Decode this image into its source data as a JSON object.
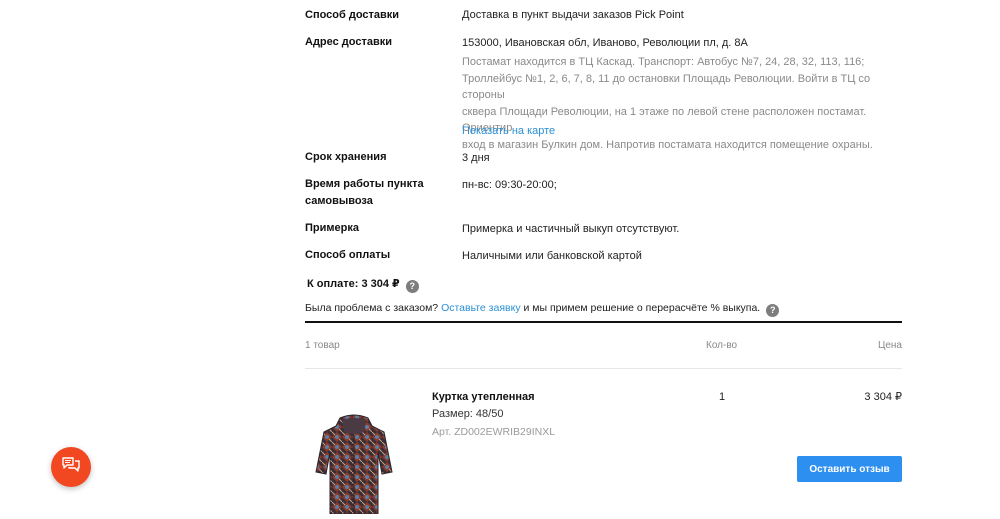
{
  "details": [
    {
      "label": "Способ доставки",
      "value": "Доставка в пункт выдачи заказов Pick Point"
    },
    {
      "label": "Адрес доставки",
      "value": "153000, Ивановская обл, Иваново, Революции пл, д. 8А",
      "note_lines": [
        "Постамат находится в ТЦ Каскад. Транспорт: Автобус №7, 24, 28, 32, 113, 116;",
        "Троллейбус №1, 2, 6, 7, 8, 11 до остановки Площадь Революции. Войти в ТЦ со стороны",
        "сквера Площади Революции, на 1 этаже по левой стене расположен постамат. Ориентир",
        "вход в магазин Булкин дом. Напротив постамата находится помещение охраны."
      ],
      "map_link": "Показать на карте"
    },
    {
      "label": "Срок хранения",
      "value": "3 дня"
    },
    {
      "label_lines": [
        "Время работы пункта",
        "самовывоза"
      ],
      "value": "пн-вс: 09:30-20:00;"
    },
    {
      "label": "Примерка",
      "value": "Примерка и частичный выкуп отсутствуют."
    },
    {
      "label": "Способ оплаты",
      "value": "Наличными или банковской картой"
    }
  ],
  "total": {
    "text": "К оплате: 3 304 ₽",
    "help_icon": "question-icon"
  },
  "problem": {
    "prefix": "Была проблема с заказом?",
    "link": "Оставьте заявку",
    "suffix": "и мы примем решение о перерасчёте % выкупа.",
    "help_icon": "question-icon"
  },
  "table": {
    "count_header": "1 товар",
    "qty_header": "Кол-во",
    "price_header": "Цена"
  },
  "item": {
    "name": "Куртка утепленная",
    "size": "Размер: 48/50",
    "article": "Арт. ZD002EWRIB29INXL",
    "qty": "1",
    "price": "3 304 ₽",
    "review_button": "Оставить отзыв"
  },
  "chat": {
    "icon": "chat-icon",
    "color": "#f24822"
  },
  "colors": {
    "accent": "#2d8ff0",
    "link": "#2a8fd6"
  }
}
